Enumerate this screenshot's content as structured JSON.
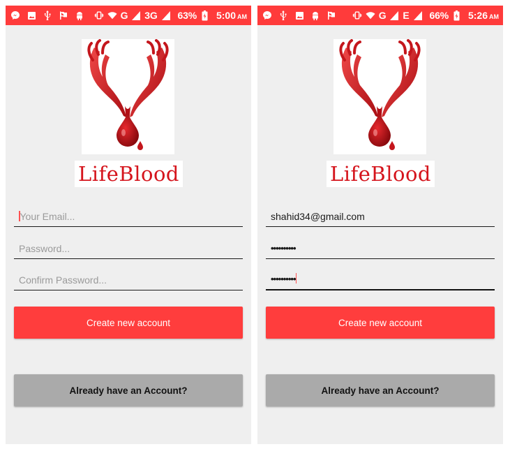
{
  "app": {
    "logo_title": "LifeBlood",
    "brand_color": "#d5141c",
    "accent_color": "#ff3d3d",
    "placeholders": {
      "email": "Your Email...",
      "password": "Password...",
      "confirm_password": "Confirm Password..."
    },
    "buttons": {
      "create": "Create new account",
      "login": "Already have an Account?"
    }
  },
  "screens": [
    {
      "status_bar": {
        "network": "G",
        "network2": "3G",
        "battery": "63%",
        "time": "5:00",
        "ampm": "AM"
      },
      "fields": {
        "email": "",
        "password": "",
        "confirm_password": ""
      },
      "focused_field": "email"
    },
    {
      "status_bar": {
        "network": "G",
        "network2": "E",
        "battery": "66%",
        "time": "5:26",
        "ampm": "AM"
      },
      "fields": {
        "email": "shahid34@gmail.com",
        "password": "••••••••••",
        "confirm_password": "••••••••••"
      },
      "focused_field": "confirm_password"
    }
  ]
}
